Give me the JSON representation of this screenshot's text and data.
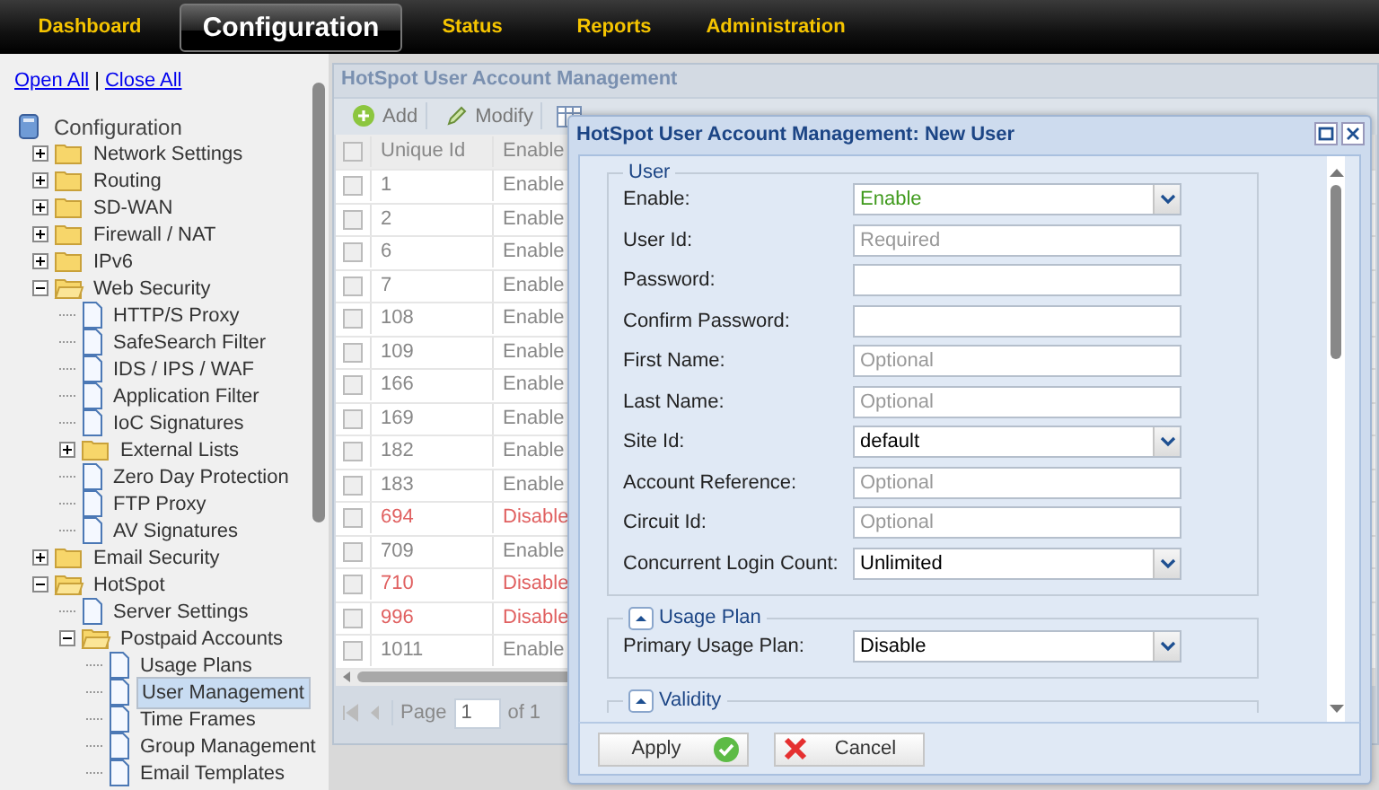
{
  "nav": {
    "tabs": [
      {
        "label": "Dashboard",
        "selected": false
      },
      {
        "label": "Configuration",
        "selected": true
      },
      {
        "label": "Status",
        "selected": false
      },
      {
        "label": "Reports",
        "selected": false
      },
      {
        "label": "Administration",
        "selected": false
      }
    ]
  },
  "sidebar": {
    "links": [
      "Open All",
      "Close All"
    ],
    "separator": "|",
    "tree": {
      "label": "Configuration",
      "kind": "root",
      "selected": false,
      "children": [
        {
          "label": "Network Settings",
          "kind": "folder",
          "expanded": false,
          "selected": false
        },
        {
          "label": "Routing",
          "kind": "folder",
          "expanded": false,
          "selected": false
        },
        {
          "label": "SD-WAN",
          "kind": "folder",
          "expanded": false,
          "selected": false
        },
        {
          "label": "Firewall / NAT",
          "kind": "folder",
          "expanded": false,
          "selected": false
        },
        {
          "label": "IPv6",
          "kind": "folder",
          "expanded": false,
          "selected": false
        },
        {
          "label": "Web Security",
          "kind": "folder",
          "expanded": true,
          "selected": false,
          "children": [
            {
              "label": "HTTP/S Proxy",
              "kind": "page",
              "selected": false
            },
            {
              "label": "SafeSearch Filter",
              "kind": "page",
              "selected": false
            },
            {
              "label": "IDS / IPS / WAF",
              "kind": "page",
              "selected": false
            },
            {
              "label": "Application Filter",
              "kind": "page",
              "selected": false
            },
            {
              "label": "IoC Signatures",
              "kind": "page",
              "selected": false
            },
            {
              "label": "External Lists",
              "kind": "folder",
              "expanded": false,
              "selected": false
            },
            {
              "label": "Zero Day Protection",
              "kind": "page",
              "selected": false
            },
            {
              "label": "FTP Proxy",
              "kind": "page",
              "selected": false
            },
            {
              "label": "AV Signatures",
              "kind": "page",
              "selected": false
            }
          ]
        },
        {
          "label": "Email Security",
          "kind": "folder",
          "expanded": false,
          "selected": false
        },
        {
          "label": "HotSpot",
          "kind": "folder",
          "expanded": true,
          "selected": false,
          "children": [
            {
              "label": "Server Settings",
              "kind": "page",
              "selected": false
            },
            {
              "label": "Postpaid Accounts",
              "kind": "folder",
              "expanded": true,
              "selected": false,
              "children": [
                {
                  "label": "Usage Plans",
                  "kind": "page",
                  "selected": false
                },
                {
                  "label": "User Management",
                  "kind": "page",
                  "selected": true
                },
                {
                  "label": "Time Frames",
                  "kind": "page",
                  "selected": false
                },
                {
                  "label": "Group Management",
                  "kind": "page",
                  "selected": false
                },
                {
                  "label": "Email Templates",
                  "kind": "page",
                  "selected": false
                }
              ]
            }
          ]
        }
      ]
    }
  },
  "panel": {
    "title": "HotSpot User Account Management",
    "toolbar": [
      {
        "label": "Add",
        "kind": "add"
      },
      {
        "label": "Modify",
        "kind": "modify"
      }
    ],
    "table": {
      "columns": [
        "Unique Id",
        "Enable"
      ],
      "header_checked": false,
      "rows": [
        {
          "id": "1",
          "enable": "Enable",
          "enabled": true,
          "checked": false
        },
        {
          "id": "2",
          "enable": "Enable",
          "enabled": true,
          "checked": false
        },
        {
          "id": "6",
          "enable": "Enable",
          "enabled": true,
          "checked": false
        },
        {
          "id": "7",
          "enable": "Enable",
          "enabled": true,
          "checked": false
        },
        {
          "id": "108",
          "enable": "Enable",
          "enabled": true,
          "checked": false
        },
        {
          "id": "109",
          "enable": "Enable",
          "enabled": true,
          "checked": false
        },
        {
          "id": "166",
          "enable": "Enable",
          "enabled": true,
          "checked": false
        },
        {
          "id": "169",
          "enable": "Enable",
          "enabled": true,
          "checked": false
        },
        {
          "id": "182",
          "enable": "Enable",
          "enabled": true,
          "checked": false
        },
        {
          "id": "183",
          "enable": "Enable",
          "enabled": true,
          "checked": false
        },
        {
          "id": "694",
          "enable": "Disable",
          "enabled": false,
          "checked": false
        },
        {
          "id": "709",
          "enable": "Enable",
          "enabled": true,
          "checked": false
        },
        {
          "id": "710",
          "enable": "Disable",
          "enabled": false,
          "checked": false
        },
        {
          "id": "996",
          "enable": "Disable",
          "enabled": false,
          "checked": false
        },
        {
          "id": "1011",
          "enable": "Enable",
          "enabled": true,
          "checked": false
        }
      ]
    },
    "pager": {
      "label": "Page",
      "value": "1",
      "total": "of 1"
    }
  },
  "dialog": {
    "title": "HotSpot User Account Management: New User",
    "sections": [
      {
        "legend": "User",
        "fields": [
          {
            "label": "Enable:",
            "kind": "select",
            "value": "Enable",
            "color": "#3f9a1c"
          },
          {
            "label": "User Id:",
            "kind": "input",
            "placeholder": "Required"
          },
          {
            "label": "Password:",
            "kind": "input"
          },
          {
            "label": "Confirm Password:",
            "kind": "input"
          },
          {
            "label": "First Name:",
            "kind": "input",
            "placeholder": "Optional"
          },
          {
            "label": "Last Name:",
            "kind": "input",
            "placeholder": "Optional"
          },
          {
            "label": "Site Id:",
            "kind": "select",
            "value": "default",
            "color": "#000000"
          },
          {
            "label": "Account Reference:",
            "kind": "input",
            "placeholder": "Optional"
          },
          {
            "label": "Circuit Id:",
            "kind": "input",
            "placeholder": "Optional"
          },
          {
            "label": "Concurrent Login Count:",
            "kind": "select",
            "value": "Unlimited",
            "color": "#000000"
          }
        ]
      },
      {
        "legend": "Usage Plan",
        "expanded": true,
        "fields": [
          {
            "label": "Primary Usage Plan:",
            "kind": "select",
            "value": "Disable",
            "color": "#000000"
          }
        ]
      },
      {
        "legend": "Validity",
        "expanded": true
      }
    ],
    "buttons": [
      {
        "label": "Apply",
        "kind": "apply"
      },
      {
        "label": "Cancel",
        "kind": "cancel"
      }
    ]
  }
}
